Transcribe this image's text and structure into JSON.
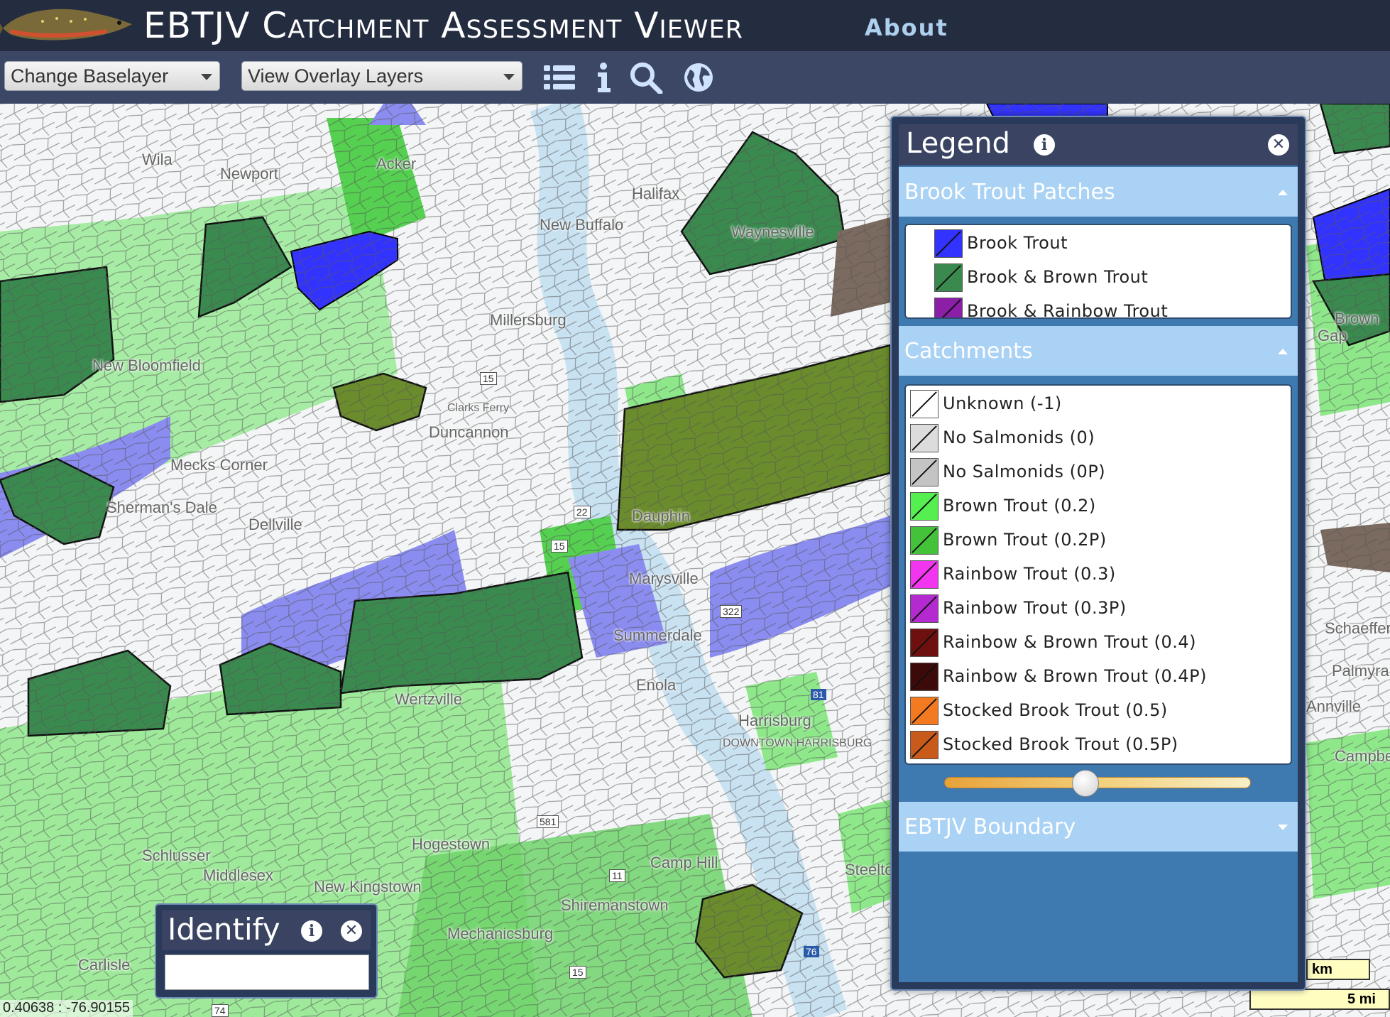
{
  "header": {
    "title": "EBTJV Catchment Assessment Viewer",
    "about_label": "About"
  },
  "toolbar": {
    "baselayer_select": "Change Baselayer",
    "overlay_select": "View Overlay Layers",
    "icons": [
      "list-icon",
      "info-icon",
      "search-icon",
      "globe-icon"
    ]
  },
  "map": {
    "place_labels": [
      "Wila",
      "Newport",
      "Acker",
      "Halifax",
      "New Buffalo",
      "Waynesville",
      "New Bloomfield",
      "Millersburg",
      "Clarks Ferry",
      "Duncannon",
      "Mecks Corner",
      "Dellville",
      "Dauphin",
      "Sherman's Dale",
      "Marysville",
      "Summerdale",
      "Enola",
      "Wertzville",
      "Harrisburg",
      "DOWNTOWN HARRISBURG",
      "Schlusser",
      "Middlesex",
      "New Kingstown",
      "Hogestown",
      "Camp Hill",
      "Steelton",
      "Shiremanstown",
      "Mechanicsburg",
      "Carlisle",
      "Palmyra",
      "Schaefferstown",
      "Campbelltown",
      "Gap",
      "Brown",
      "Annville"
    ],
    "coordinates": "0.40638 : -76.90155",
    "scale_km": "km",
    "scale_mi": "5 mi",
    "road_shields": [
      "15",
      "22",
      "15",
      "322",
      "81",
      "76",
      "11",
      "15",
      "581",
      "74"
    ]
  },
  "legend": {
    "title": "Legend",
    "sections": [
      {
        "title": "Brook Trout Patches",
        "items": [
          {
            "label": "Brook Trout",
            "color": "#3333ff"
          },
          {
            "label": "Brook & Brown Trout",
            "color": "#3a8a4f"
          },
          {
            "label": "Brook & Rainbow Trout",
            "color": "#8b1fa8"
          }
        ]
      },
      {
        "title": "Catchments",
        "items": [
          {
            "label": "Unknown (-1)",
            "color": "#ffffff"
          },
          {
            "label": "No Salmonids (0)",
            "color": "#dcdcdc"
          },
          {
            "label": "No Salmonids (0P)",
            "color": "#c4c4c4"
          },
          {
            "label": "Brown Trout (0.2)",
            "color": "#55f050"
          },
          {
            "label": "Brown Trout (0.2P)",
            "color": "#44c23a"
          },
          {
            "label": "Rainbow Trout (0.3)",
            "color": "#f236f0"
          },
          {
            "label": "Rainbow Trout (0.3P)",
            "color": "#b42ad0"
          },
          {
            "label": "Rainbow & Brown Trout (0.4)",
            "color": "#6e1010"
          },
          {
            "label": "Rainbow & Brown Trout (0.4P)",
            "color": "#3d0a0a"
          },
          {
            "label": "Stocked Brook Trout (0.5)",
            "color": "#f47a22"
          },
          {
            "label": "Stocked Brook Trout (0.5P)",
            "color": "#c85a1c"
          }
        ]
      },
      {
        "title": "EBTJV Boundary"
      }
    ],
    "opacity": 0.44
  },
  "identify": {
    "title": "Identify"
  }
}
